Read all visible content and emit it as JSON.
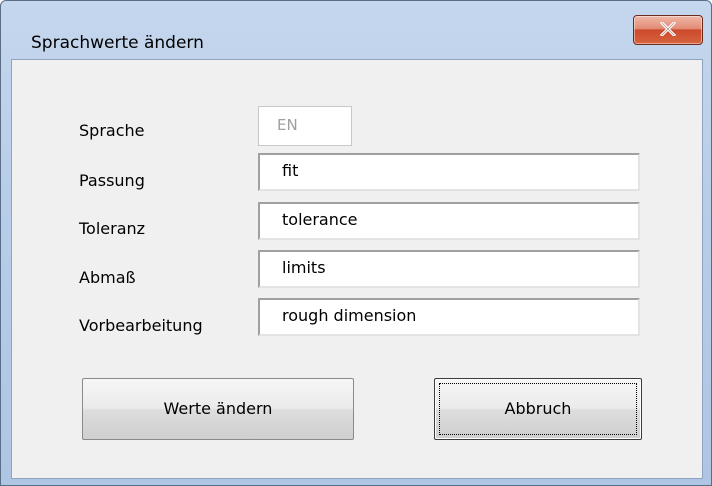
{
  "window": {
    "title": "Sprachwerte ändern"
  },
  "form": {
    "fields": [
      {
        "label": "Sprache",
        "value": "EN"
      },
      {
        "label": "Passung",
        "value": "fit"
      },
      {
        "label": "Toleranz",
        "value": "tolerance"
      },
      {
        "label": "Abmaß",
        "value": "limits"
      },
      {
        "label": "Vorbearbeitung",
        "value": "rough dimension"
      }
    ]
  },
  "buttons": {
    "apply_label": "Werte ändern",
    "cancel_label": "Abbruch"
  },
  "icons": {
    "close": "close-icon"
  },
  "colors": {
    "close_button": "#cc4a2c",
    "dialog_background": "#f0f0f0",
    "frame": "#b8cde8"
  }
}
